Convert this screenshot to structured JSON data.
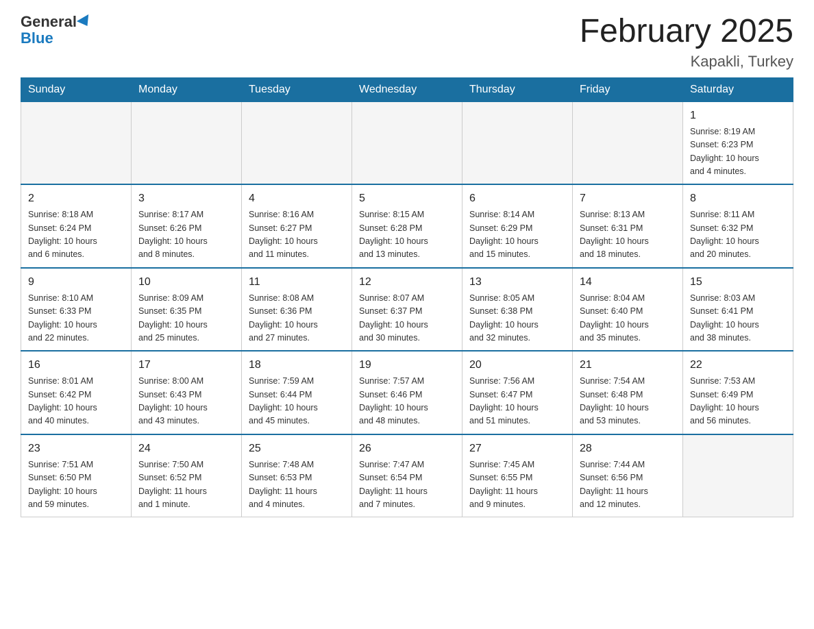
{
  "logo": {
    "general": "General",
    "blue": "Blue"
  },
  "header": {
    "month_title": "February 2025",
    "location": "Kapakli, Turkey"
  },
  "weekdays": [
    "Sunday",
    "Monday",
    "Tuesday",
    "Wednesday",
    "Thursday",
    "Friday",
    "Saturday"
  ],
  "weeks": [
    [
      {
        "day": "",
        "info": ""
      },
      {
        "day": "",
        "info": ""
      },
      {
        "day": "",
        "info": ""
      },
      {
        "day": "",
        "info": ""
      },
      {
        "day": "",
        "info": ""
      },
      {
        "day": "",
        "info": ""
      },
      {
        "day": "1",
        "info": "Sunrise: 8:19 AM\nSunset: 6:23 PM\nDaylight: 10 hours\nand 4 minutes."
      }
    ],
    [
      {
        "day": "2",
        "info": "Sunrise: 8:18 AM\nSunset: 6:24 PM\nDaylight: 10 hours\nand 6 minutes."
      },
      {
        "day": "3",
        "info": "Sunrise: 8:17 AM\nSunset: 6:26 PM\nDaylight: 10 hours\nand 8 minutes."
      },
      {
        "day": "4",
        "info": "Sunrise: 8:16 AM\nSunset: 6:27 PM\nDaylight: 10 hours\nand 11 minutes."
      },
      {
        "day": "5",
        "info": "Sunrise: 8:15 AM\nSunset: 6:28 PM\nDaylight: 10 hours\nand 13 minutes."
      },
      {
        "day": "6",
        "info": "Sunrise: 8:14 AM\nSunset: 6:29 PM\nDaylight: 10 hours\nand 15 minutes."
      },
      {
        "day": "7",
        "info": "Sunrise: 8:13 AM\nSunset: 6:31 PM\nDaylight: 10 hours\nand 18 minutes."
      },
      {
        "day": "8",
        "info": "Sunrise: 8:11 AM\nSunset: 6:32 PM\nDaylight: 10 hours\nand 20 minutes."
      }
    ],
    [
      {
        "day": "9",
        "info": "Sunrise: 8:10 AM\nSunset: 6:33 PM\nDaylight: 10 hours\nand 22 minutes."
      },
      {
        "day": "10",
        "info": "Sunrise: 8:09 AM\nSunset: 6:35 PM\nDaylight: 10 hours\nand 25 minutes."
      },
      {
        "day": "11",
        "info": "Sunrise: 8:08 AM\nSunset: 6:36 PM\nDaylight: 10 hours\nand 27 minutes."
      },
      {
        "day": "12",
        "info": "Sunrise: 8:07 AM\nSunset: 6:37 PM\nDaylight: 10 hours\nand 30 minutes."
      },
      {
        "day": "13",
        "info": "Sunrise: 8:05 AM\nSunset: 6:38 PM\nDaylight: 10 hours\nand 32 minutes."
      },
      {
        "day": "14",
        "info": "Sunrise: 8:04 AM\nSunset: 6:40 PM\nDaylight: 10 hours\nand 35 minutes."
      },
      {
        "day": "15",
        "info": "Sunrise: 8:03 AM\nSunset: 6:41 PM\nDaylight: 10 hours\nand 38 minutes."
      }
    ],
    [
      {
        "day": "16",
        "info": "Sunrise: 8:01 AM\nSunset: 6:42 PM\nDaylight: 10 hours\nand 40 minutes."
      },
      {
        "day": "17",
        "info": "Sunrise: 8:00 AM\nSunset: 6:43 PM\nDaylight: 10 hours\nand 43 minutes."
      },
      {
        "day": "18",
        "info": "Sunrise: 7:59 AM\nSunset: 6:44 PM\nDaylight: 10 hours\nand 45 minutes."
      },
      {
        "day": "19",
        "info": "Sunrise: 7:57 AM\nSunset: 6:46 PM\nDaylight: 10 hours\nand 48 minutes."
      },
      {
        "day": "20",
        "info": "Sunrise: 7:56 AM\nSunset: 6:47 PM\nDaylight: 10 hours\nand 51 minutes."
      },
      {
        "day": "21",
        "info": "Sunrise: 7:54 AM\nSunset: 6:48 PM\nDaylight: 10 hours\nand 53 minutes."
      },
      {
        "day": "22",
        "info": "Sunrise: 7:53 AM\nSunset: 6:49 PM\nDaylight: 10 hours\nand 56 minutes."
      }
    ],
    [
      {
        "day": "23",
        "info": "Sunrise: 7:51 AM\nSunset: 6:50 PM\nDaylight: 10 hours\nand 59 minutes."
      },
      {
        "day": "24",
        "info": "Sunrise: 7:50 AM\nSunset: 6:52 PM\nDaylight: 11 hours\nand 1 minute."
      },
      {
        "day": "25",
        "info": "Sunrise: 7:48 AM\nSunset: 6:53 PM\nDaylight: 11 hours\nand 4 minutes."
      },
      {
        "day": "26",
        "info": "Sunrise: 7:47 AM\nSunset: 6:54 PM\nDaylight: 11 hours\nand 7 minutes."
      },
      {
        "day": "27",
        "info": "Sunrise: 7:45 AM\nSunset: 6:55 PM\nDaylight: 11 hours\nand 9 minutes."
      },
      {
        "day": "28",
        "info": "Sunrise: 7:44 AM\nSunset: 6:56 PM\nDaylight: 11 hours\nand 12 minutes."
      },
      {
        "day": "",
        "info": ""
      }
    ]
  ]
}
